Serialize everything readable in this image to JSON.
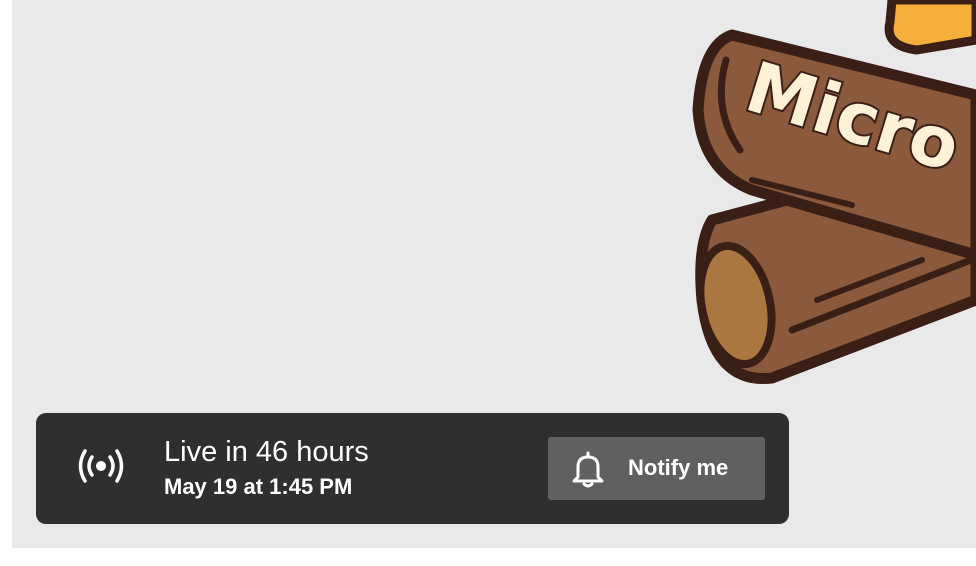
{
  "thumbnail": {
    "background_color": "#e9e9e9",
    "logo_text": "Micro"
  },
  "live_banner": {
    "icon": "live-broadcast-icon",
    "title": "Live in 46 hours",
    "schedule": "May 19 at 1:45 PM",
    "notify_button": {
      "icon": "bell-icon",
      "label": "Notify me"
    }
  },
  "colors": {
    "banner_bg": "#2f2f2f",
    "button_bg": "#606060",
    "log_brown": "#8b5a3c",
    "log_outline": "#3a1f17",
    "flame_orange": "#f4b03a"
  }
}
